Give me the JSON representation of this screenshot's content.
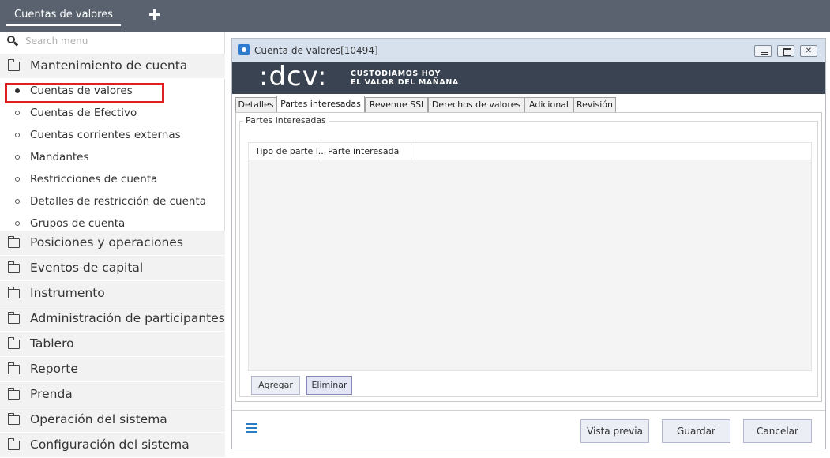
{
  "topbar": {
    "tab_label": "Cuentas de valores",
    "add_icon": "plus-icon"
  },
  "sidebar": {
    "search_placeholder": "Search menu",
    "groups": [
      {
        "label": "Mantenimiento de cuenta",
        "icon": "folder-open-icon",
        "expanded": true
      },
      {
        "label": "Posiciones y operaciones",
        "icon": "folder-icon"
      },
      {
        "label": "Eventos de capital",
        "icon": "folder-icon"
      },
      {
        "label": "Instrumento",
        "icon": "folder-icon"
      },
      {
        "label": "Administración de participantes",
        "icon": "folder-icon"
      },
      {
        "label": "Tablero",
        "icon": "folder-icon"
      },
      {
        "label": "Reporte",
        "icon": "folder-icon"
      },
      {
        "label": "Prenda",
        "icon": "folder-icon"
      },
      {
        "label": "Operación del sistema",
        "icon": "folder-icon"
      },
      {
        "label": "Configuración del sistema",
        "icon": "folder-icon"
      }
    ],
    "subitems": [
      {
        "label": "Cuentas de valores",
        "selected": true
      },
      {
        "label": "Cuentas de Efectivo"
      },
      {
        "label": "Cuentas corrientes externas"
      },
      {
        "label": "Mandantes"
      },
      {
        "label": "Restricciones de cuenta"
      },
      {
        "label": "Detalles de restricción de cuenta"
      },
      {
        "label": "Grupos de cuenta"
      }
    ],
    "highlight_color": "#e02020"
  },
  "window": {
    "title": "Cuenta de valores[10494]",
    "banner": {
      "logo_text": ":dcv:",
      "tagline_1": "CUSTODIAMOS HOY",
      "tagline_2": "EL VALOR DEL MAÑANA"
    },
    "tabs": [
      "Detalles",
      "Partes interesadas",
      "Revenue SSI",
      "Derechos de valores",
      "Adicional",
      "Revisión"
    ],
    "active_tab": "Partes interesadas",
    "section_title": "Partes interesadas",
    "grid_columns": [
      "Tipo de parte i...",
      "Parte interesada"
    ],
    "buttons": {
      "add": "Agregar",
      "remove": "Eliminar"
    },
    "footer": {
      "preview": "Vista previa",
      "save": "Guardar",
      "cancel": "Cancelar"
    }
  },
  "colors": {
    "topbar": "#59626e",
    "banner": "#3a4352",
    "accent": "#2b7cc1"
  }
}
